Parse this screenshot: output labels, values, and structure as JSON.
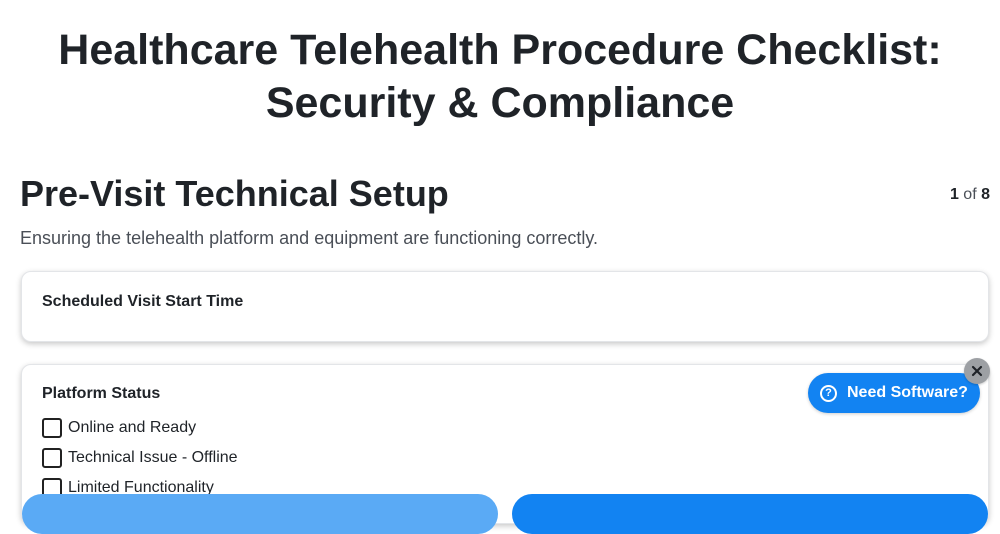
{
  "page": {
    "title_line1": "Healthcare Telehealth Procedure Checklist:",
    "title_line2": "Security & Compliance"
  },
  "section": {
    "title": "Pre-Visit Technical Setup",
    "description": "Ensuring the telehealth platform and equipment are functioning correctly.",
    "pager_current": "1",
    "pager_of": "of",
    "pager_total": "8"
  },
  "fields": {
    "start_time": {
      "label": "Scheduled Visit Start Time"
    },
    "platform_status": {
      "label": "Platform Status",
      "options": [
        {
          "label": "Online and Ready",
          "checked": false
        },
        {
          "label": "Technical Issue - Offline",
          "checked": false
        },
        {
          "label": "Limited Functionality",
          "checked": false
        }
      ]
    }
  },
  "help_widget": {
    "label": "Need Software?",
    "icon": "question-circle-icon",
    "close_icon": "close-icon"
  },
  "colors": {
    "accent": "#1283f2",
    "accent_light": "#5aaaf5",
    "close_bg": "#9da0a4",
    "text": "#1f2328",
    "muted_text": "#4a4f57"
  }
}
